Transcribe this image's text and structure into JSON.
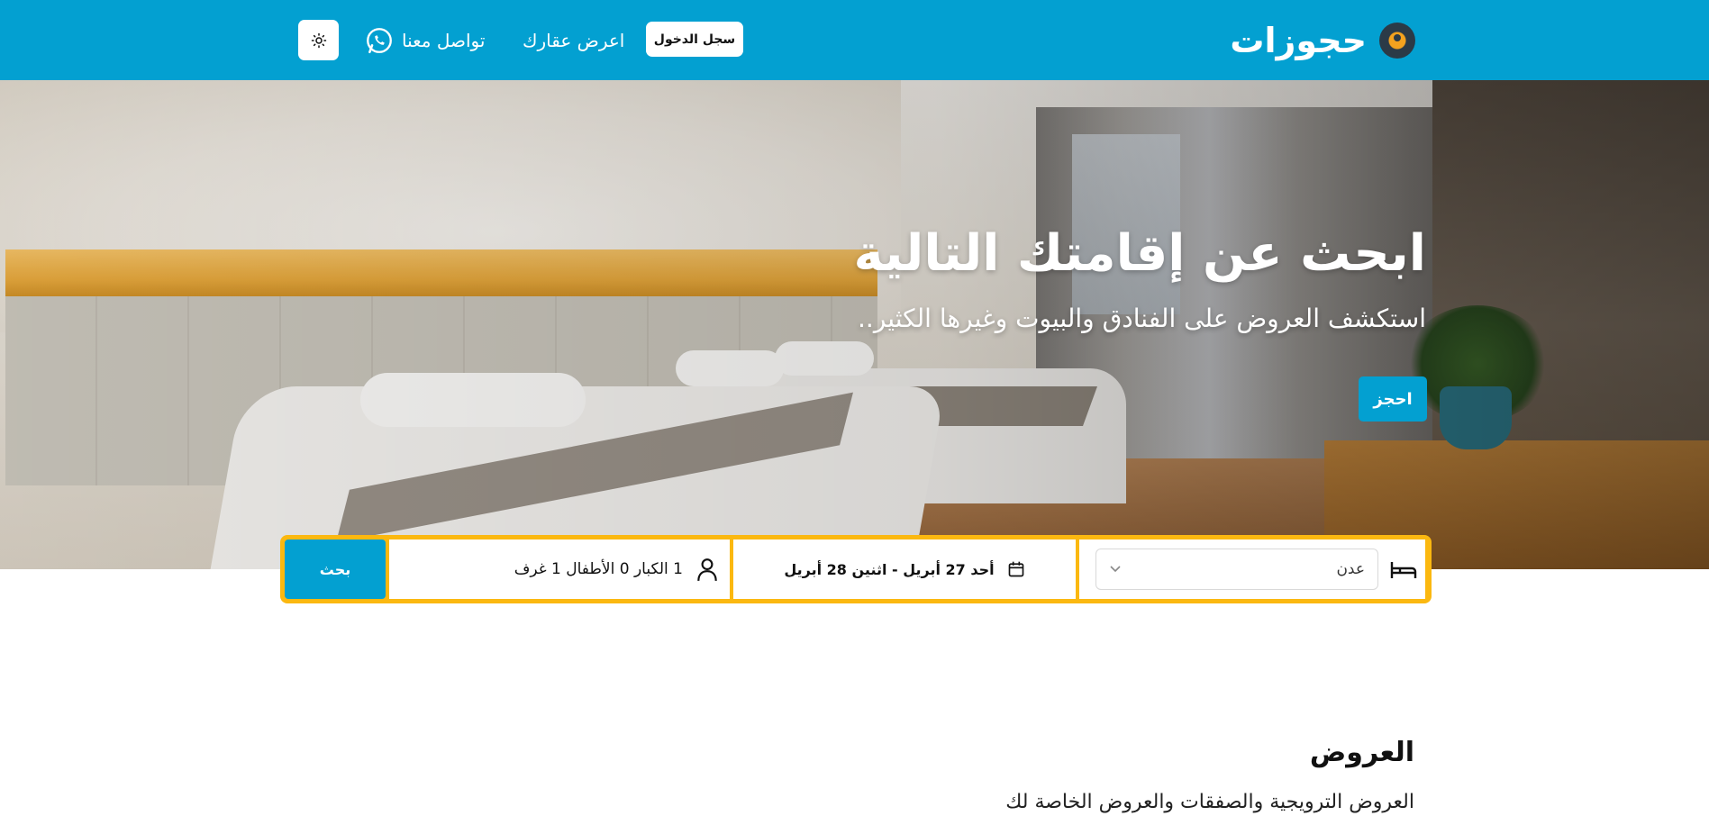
{
  "header": {
    "brand_name": "حجوزات",
    "login_label": "سجل الدخول",
    "list_property_label": "اعرض عقارك",
    "contact_label": "تواصل معنا"
  },
  "hero": {
    "title": "ابحث عن إقامتك التالية",
    "subtitle": "استكشف العروض على الفنادق والبيوت وغيرها الكثير..",
    "book_label": "احجز"
  },
  "search": {
    "destination_value": "عدن",
    "dates_value": "أحد 27 أبريل - اثنين 28 أبريل",
    "guests_value": "1 الكبار 0 الأطفال 1 غرف",
    "search_label": "بحث"
  },
  "offers": {
    "title": "العروض",
    "subtitle": "العروض الترويجية والصفقات والعروض الخاصة لك"
  },
  "colors": {
    "primary": "#03a0d1",
    "search_border": "#fbb810"
  },
  "icons": {
    "logo": "location-pin-logo",
    "whatsapp": "whatsapp-icon",
    "theme": "sun-icon",
    "bed": "bed-icon",
    "calendar": "calendar-icon",
    "person": "person-icon",
    "chevron": "chevron-down-icon"
  }
}
